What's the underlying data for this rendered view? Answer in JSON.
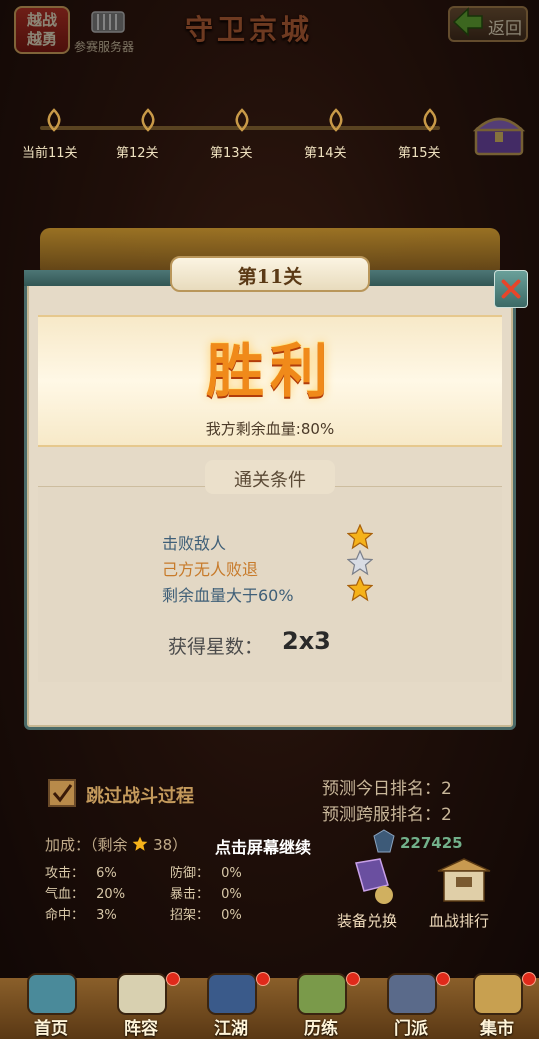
{
  "header": {
    "event_badge": "越战\n越勇",
    "server_label": "参赛服务器",
    "title": "守卫京城",
    "back_label": "返回"
  },
  "stages": [
    "当前11关",
    "第12关",
    "第13关",
    "第14关",
    "第15关"
  ],
  "dialog": {
    "stage_title": "第11关",
    "result": "胜利",
    "hp_remaining": "我方剩余血量:80%",
    "conditions_title": "通关条件",
    "conditions": [
      {
        "text": "击败敌人",
        "achieved": true
      },
      {
        "text": "己方无人败退",
        "achieved": false
      },
      {
        "text": "剩余血量大于60%",
        "achieved": true
      }
    ],
    "stars_label": "获得星数：",
    "stars_value": "2x3"
  },
  "skip_battle_label": "跳过战斗过程",
  "rank": {
    "today": "预测今日排名：2",
    "cross_server": "预测跨服排名：2"
  },
  "bonus": {
    "label": "加成：（剩余",
    "stars_left": "38）",
    "continue_hint": "点击屏幕继续",
    "power_value": "227425"
  },
  "stats": [
    {
      "label": "攻击：",
      "value": "6%"
    },
    {
      "label": "防御：",
      "value": "0%"
    },
    {
      "label": "气血：",
      "value": "20%"
    },
    {
      "label": "暴击：",
      "value": "0%"
    },
    {
      "label": "命中：",
      "value": "3%"
    },
    {
      "label": "招架：",
      "value": "0%"
    }
  ],
  "side_buttons": [
    "装备兑换",
    "血战排行"
  ],
  "nav": [
    "首页",
    "阵容",
    "江湖",
    "历练",
    "门派",
    "集市"
  ],
  "colors": {
    "victory": "#f08a1a",
    "star_gold": "#f5b21a",
    "star_silver": "#d8dce4",
    "teal": "#4d7675"
  }
}
